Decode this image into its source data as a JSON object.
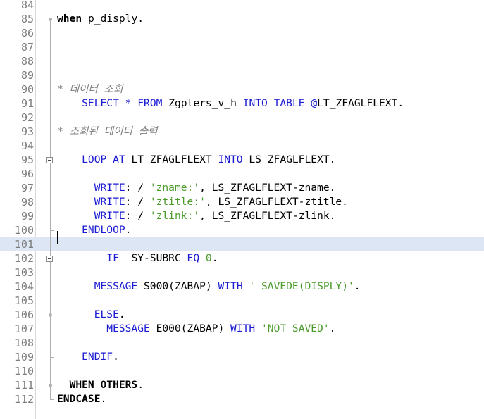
{
  "editor": {
    "lines": [
      {
        "num": "84",
        "tokens": []
      },
      {
        "num": "85",
        "tokens": [
          {
            "t": "when",
            "c": "kwb"
          },
          {
            "t": " p_disply.",
            "c": ""
          }
        ]
      },
      {
        "num": "86",
        "tokens": []
      },
      {
        "num": "87",
        "tokens": []
      },
      {
        "num": "88",
        "tokens": []
      },
      {
        "num": "89",
        "tokens": []
      },
      {
        "num": "90",
        "tokens": [
          {
            "t": "* 데이터 조회",
            "c": "cmt"
          }
        ]
      },
      {
        "num": "91",
        "tokens": [
          {
            "t": "    SELECT",
            "c": "kw"
          },
          {
            "t": " ",
            "c": ""
          },
          {
            "t": "*",
            "c": "kw"
          },
          {
            "t": " ",
            "c": ""
          },
          {
            "t": "FROM",
            "c": "kw"
          },
          {
            "t": " Zgpters_v_h ",
            "c": ""
          },
          {
            "t": "INTO TABLE",
            "c": "kw"
          },
          {
            "t": " ",
            "c": ""
          },
          {
            "t": "@",
            "c": "kw"
          },
          {
            "t": "LT_ZFAGLFLEXT.",
            "c": ""
          }
        ]
      },
      {
        "num": "92",
        "tokens": []
      },
      {
        "num": "93",
        "tokens": [
          {
            "t": "* 조회된 데이터 출력",
            "c": "cmt"
          }
        ]
      },
      {
        "num": "94",
        "tokens": []
      },
      {
        "num": "95",
        "tokens": [
          {
            "t": "    LOOP AT",
            "c": "kw"
          },
          {
            "t": " LT_ZFAGLFLEXT ",
            "c": ""
          },
          {
            "t": "INTO",
            "c": "kw"
          },
          {
            "t": " LS_ZFAGLFLEXT.",
            "c": ""
          }
        ]
      },
      {
        "num": "96",
        "tokens": []
      },
      {
        "num": "97",
        "tokens": [
          {
            "t": "      WRITE",
            "c": "kw"
          },
          {
            "t": ": / ",
            "c": ""
          },
          {
            "t": "'zname:'",
            "c": "str"
          },
          {
            "t": ", LS_ZFAGLFLEXT-zname.",
            "c": ""
          }
        ]
      },
      {
        "num": "98",
        "tokens": [
          {
            "t": "      WRITE",
            "c": "kw"
          },
          {
            "t": ": / ",
            "c": ""
          },
          {
            "t": "'ztitle:'",
            "c": "str"
          },
          {
            "t": ", LS_ZFAGLFLEXT-ztitle.",
            "c": ""
          }
        ]
      },
      {
        "num": "99",
        "tokens": [
          {
            "t": "      WRITE",
            "c": "kw"
          },
          {
            "t": ": / ",
            "c": ""
          },
          {
            "t": "'zlink:'",
            "c": "str"
          },
          {
            "t": ", LS_ZFAGLFLEXT-zlink.",
            "c": ""
          }
        ]
      },
      {
        "num": "100",
        "tokens": [
          {
            "t": "    ENDLOOP",
            "c": "kw"
          },
          {
            "t": ".",
            "c": ""
          }
        ]
      },
      {
        "num": "101",
        "tokens": [],
        "current": true
      },
      {
        "num": "102",
        "tokens": [
          {
            "t": "        IF",
            "c": "kw"
          },
          {
            "t": "  SY-SUBRC ",
            "c": ""
          },
          {
            "t": "EQ",
            "c": "kw"
          },
          {
            "t": " ",
            "c": ""
          },
          {
            "t": "0",
            "c": "num"
          },
          {
            "t": ".",
            "c": ""
          }
        ]
      },
      {
        "num": "103",
        "tokens": []
      },
      {
        "num": "104",
        "tokens": [
          {
            "t": "      MESSAGE",
            "c": "kw"
          },
          {
            "t": " S000(ZABAP) ",
            "c": ""
          },
          {
            "t": "WITH",
            "c": "kw"
          },
          {
            "t": " ",
            "c": ""
          },
          {
            "t": "' SAVEDE(DISPLY)'",
            "c": "str"
          },
          {
            "t": ".",
            "c": ""
          }
        ]
      },
      {
        "num": "105",
        "tokens": []
      },
      {
        "num": "106",
        "tokens": [
          {
            "t": "      ELSE",
            "c": "kw"
          },
          {
            "t": ".",
            "c": ""
          }
        ]
      },
      {
        "num": "107",
        "tokens": [
          {
            "t": "        MESSAGE",
            "c": "kw"
          },
          {
            "t": " E000(ZABAP) ",
            "c": ""
          },
          {
            "t": "WITH",
            "c": "kw"
          },
          {
            "t": " ",
            "c": ""
          },
          {
            "t": "'NOT SAVED'",
            "c": "str"
          },
          {
            "t": ".",
            "c": ""
          }
        ]
      },
      {
        "num": "108",
        "tokens": []
      },
      {
        "num": "109",
        "tokens": [
          {
            "t": "    ENDIF",
            "c": "kw"
          },
          {
            "t": ".",
            "c": ""
          }
        ]
      },
      {
        "num": "110",
        "tokens": []
      },
      {
        "num": "111",
        "tokens": [
          {
            "t": "  WHEN OTHERS",
            "c": "kwb"
          },
          {
            "t": ".",
            "c": ""
          }
        ]
      },
      {
        "num": "112",
        "tokens": [
          {
            "t": "ENDCASE",
            "c": "kwb"
          },
          {
            "t": ".",
            "c": ""
          }
        ]
      }
    ]
  }
}
